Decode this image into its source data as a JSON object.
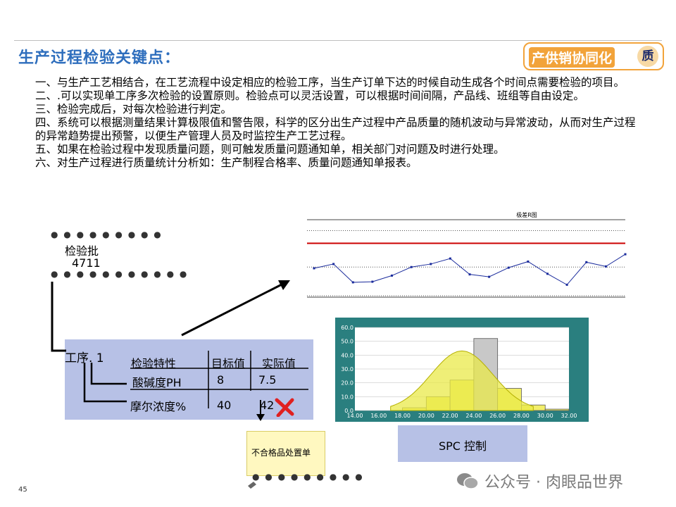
{
  "title": "生产过程检验关键点：",
  "badge": {
    "label": "产供销协同化",
    "circle": "质"
  },
  "paragraphs": [
    "一、与生产工艺相结合，在工艺流程中设定相应的检验工序，当生产订单下达的时候自动生成各个时间点需要检验的项目。",
    "二、.可以实现单工序多次检验的设置原则。检验点可以灵活设置，可以根据时间间隔，产品线、班组等自由设定。",
    "三、检验完成后，对每次检验进行判定。",
    "四、系统可以根据测量结果计算极限值和警告限，科学的区分出生产过程中产品质量的随机波动与异常波动，从而对生产过程的异常趋势提出预警，以便生产管理人员及时监控生产工艺过程。",
    "五、如果在检验过程中发现质量问题，则可触发质量问题通知单，相关部门对问题及时进行处理。",
    "六、对生产过程进行质量统计分析如：生产制程合格率、质量问题通知单报表。"
  ],
  "batch": {
    "label": "检验批",
    "number": "4711"
  },
  "procedure": {
    "label": "工序. 1",
    "headers": [
      "检验特性",
      "目标值",
      "实际值"
    ],
    "rows": [
      [
        "酸碱度PH",
        "8",
        "7.5"
      ],
      [
        "摩尔浓度%",
        "40",
        "42"
      ]
    ]
  },
  "note_label": "不合格品处置单",
  "spc_label": "SPC 控制",
  "watermark": "公众号 · 肉眼品世界",
  "page_number": "45",
  "colors": {
    "title": "#2e6ebd",
    "badge": "#f2a33a",
    "panel": "#b7c1e6",
    "limit_line": "#cc0000",
    "series": "#1a2b9c",
    "hist_frame": "#2a7f7f",
    "hist_bars": "#f2ee6a",
    "normal_fill": "#e9e94a",
    "reject_mark": "#e02020"
  },
  "chart_data": [
    {
      "type": "line",
      "title": "极差R图",
      "x": [
        1,
        2,
        3,
        4,
        5,
        6,
        7,
        8,
        9,
        10,
        11,
        12,
        13,
        14,
        15,
        16,
        17
      ],
      "values": [
        15,
        22,
        -8,
        -7,
        3,
        17,
        22,
        31,
        5,
        1,
        16,
        26,
        6,
        -12,
        25,
        18,
        38
      ],
      "ylim": [
        -30,
        90
      ],
      "upper_limit": 56,
      "center_line": 17,
      "lower_limit": -35
    },
    {
      "type": "bar",
      "title": "",
      "xlabel": "",
      "ylabel": "",
      "categories": [
        "14.00",
        "16.00",
        "18.00",
        "20.00",
        "22.00",
        "24.00",
        "26.00",
        "28.00",
        "30.00",
        "32.00"
      ],
      "bins": [
        [
          14,
          16
        ],
        [
          16,
          18
        ],
        [
          18,
          20
        ],
        [
          20,
          22
        ],
        [
          22,
          24
        ],
        [
          24,
          26
        ],
        [
          26,
          28
        ],
        [
          28,
          30
        ],
        [
          30,
          32
        ]
      ],
      "values": [
        0,
        0,
        2,
        10,
        22,
        52,
        16,
        4,
        1,
        0
      ],
      "ylim": [
        0,
        60
      ],
      "yticks": [
        "0.0",
        "10.0",
        "20.0",
        "30.0",
        "40.0",
        "50.0",
        "60.0"
      ],
      "normal_curve": {
        "mean": 23,
        "sd": 2.6,
        "peak": 43
      }
    }
  ]
}
